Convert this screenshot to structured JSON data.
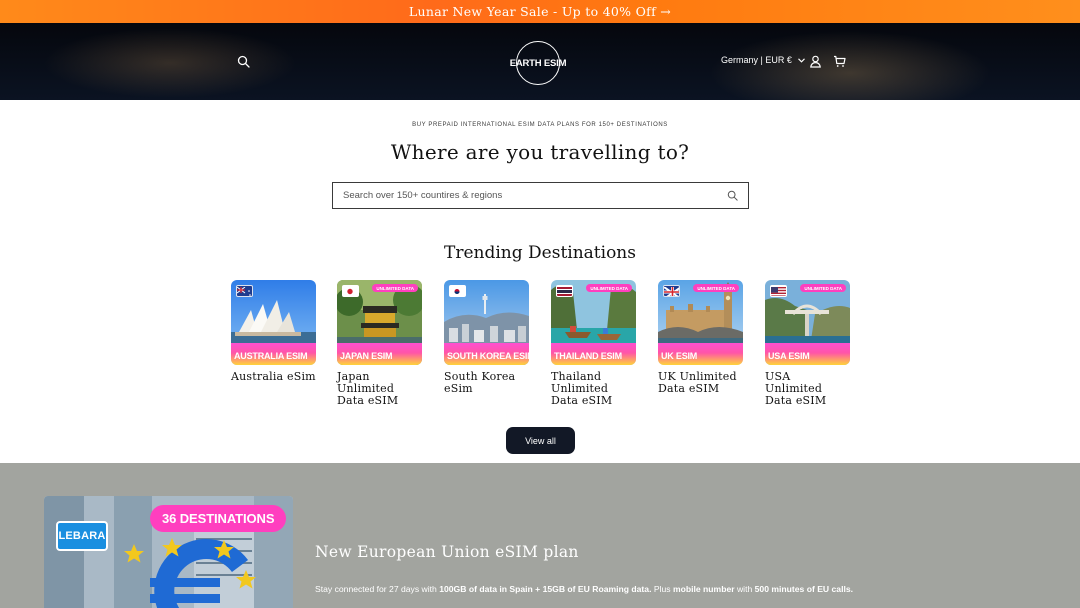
{
  "announcement": {
    "text": "Lunar New Year Sale - Up to 40% Off →"
  },
  "header": {
    "logo_text": "EARTH ESIM",
    "locale": "Germany | EUR €"
  },
  "hero": {
    "eyebrow": "BUY PREPAID INTERNATIONAL ESIM DATA PLANS FOR 150+ DESTINATIONS",
    "title": "Where are you travelling to?",
    "search_placeholder": "Search over 150+ countires & regions"
  },
  "trending": {
    "title": "Trending Destinations",
    "pill_label": "UNLIMITED DATA",
    "items": [
      {
        "band": "AUSTRALIA ESIM",
        "name": "Australia eSim"
      },
      {
        "band": "JAPAN ESIM",
        "name": "Japan Unlimited Data eSIM"
      },
      {
        "band": "SOUTH KOREA ESIM",
        "name": "South Korea eSim"
      },
      {
        "band": "THAILAND ESIM",
        "name": "Thailand Unlimited Data eSIM"
      },
      {
        "band": "UK ESIM",
        "name": "UK Unlimited Data eSIM"
      },
      {
        "band": "USA ESIM",
        "name": "USA Unlimited Data eSIM"
      }
    ],
    "view_all": "View all"
  },
  "eu_plan": {
    "badge": "36 DESTINATIONS",
    "provider_logo": "LEBARA",
    "title": "New European Union eSIM plan",
    "desc_1": "Stay connected for 27 days with ",
    "desc_2": "100GB of data in Spain + 15GB of EU Roaming data.",
    "desc_3": " Plus ",
    "desc_4": "mobile number",
    "desc_5": " with ",
    "desc_6": "500 minutes of EU calls."
  },
  "colors": {
    "announcement": "#ff7a10",
    "button_dark": "#121826",
    "band_pink": "#ff4fd0",
    "band_yellow": "#ffd43a",
    "eu_section": "#a2a49f"
  },
  "icons": [
    "search-icon",
    "user-icon",
    "cart-icon",
    "chevron-down-icon"
  ]
}
